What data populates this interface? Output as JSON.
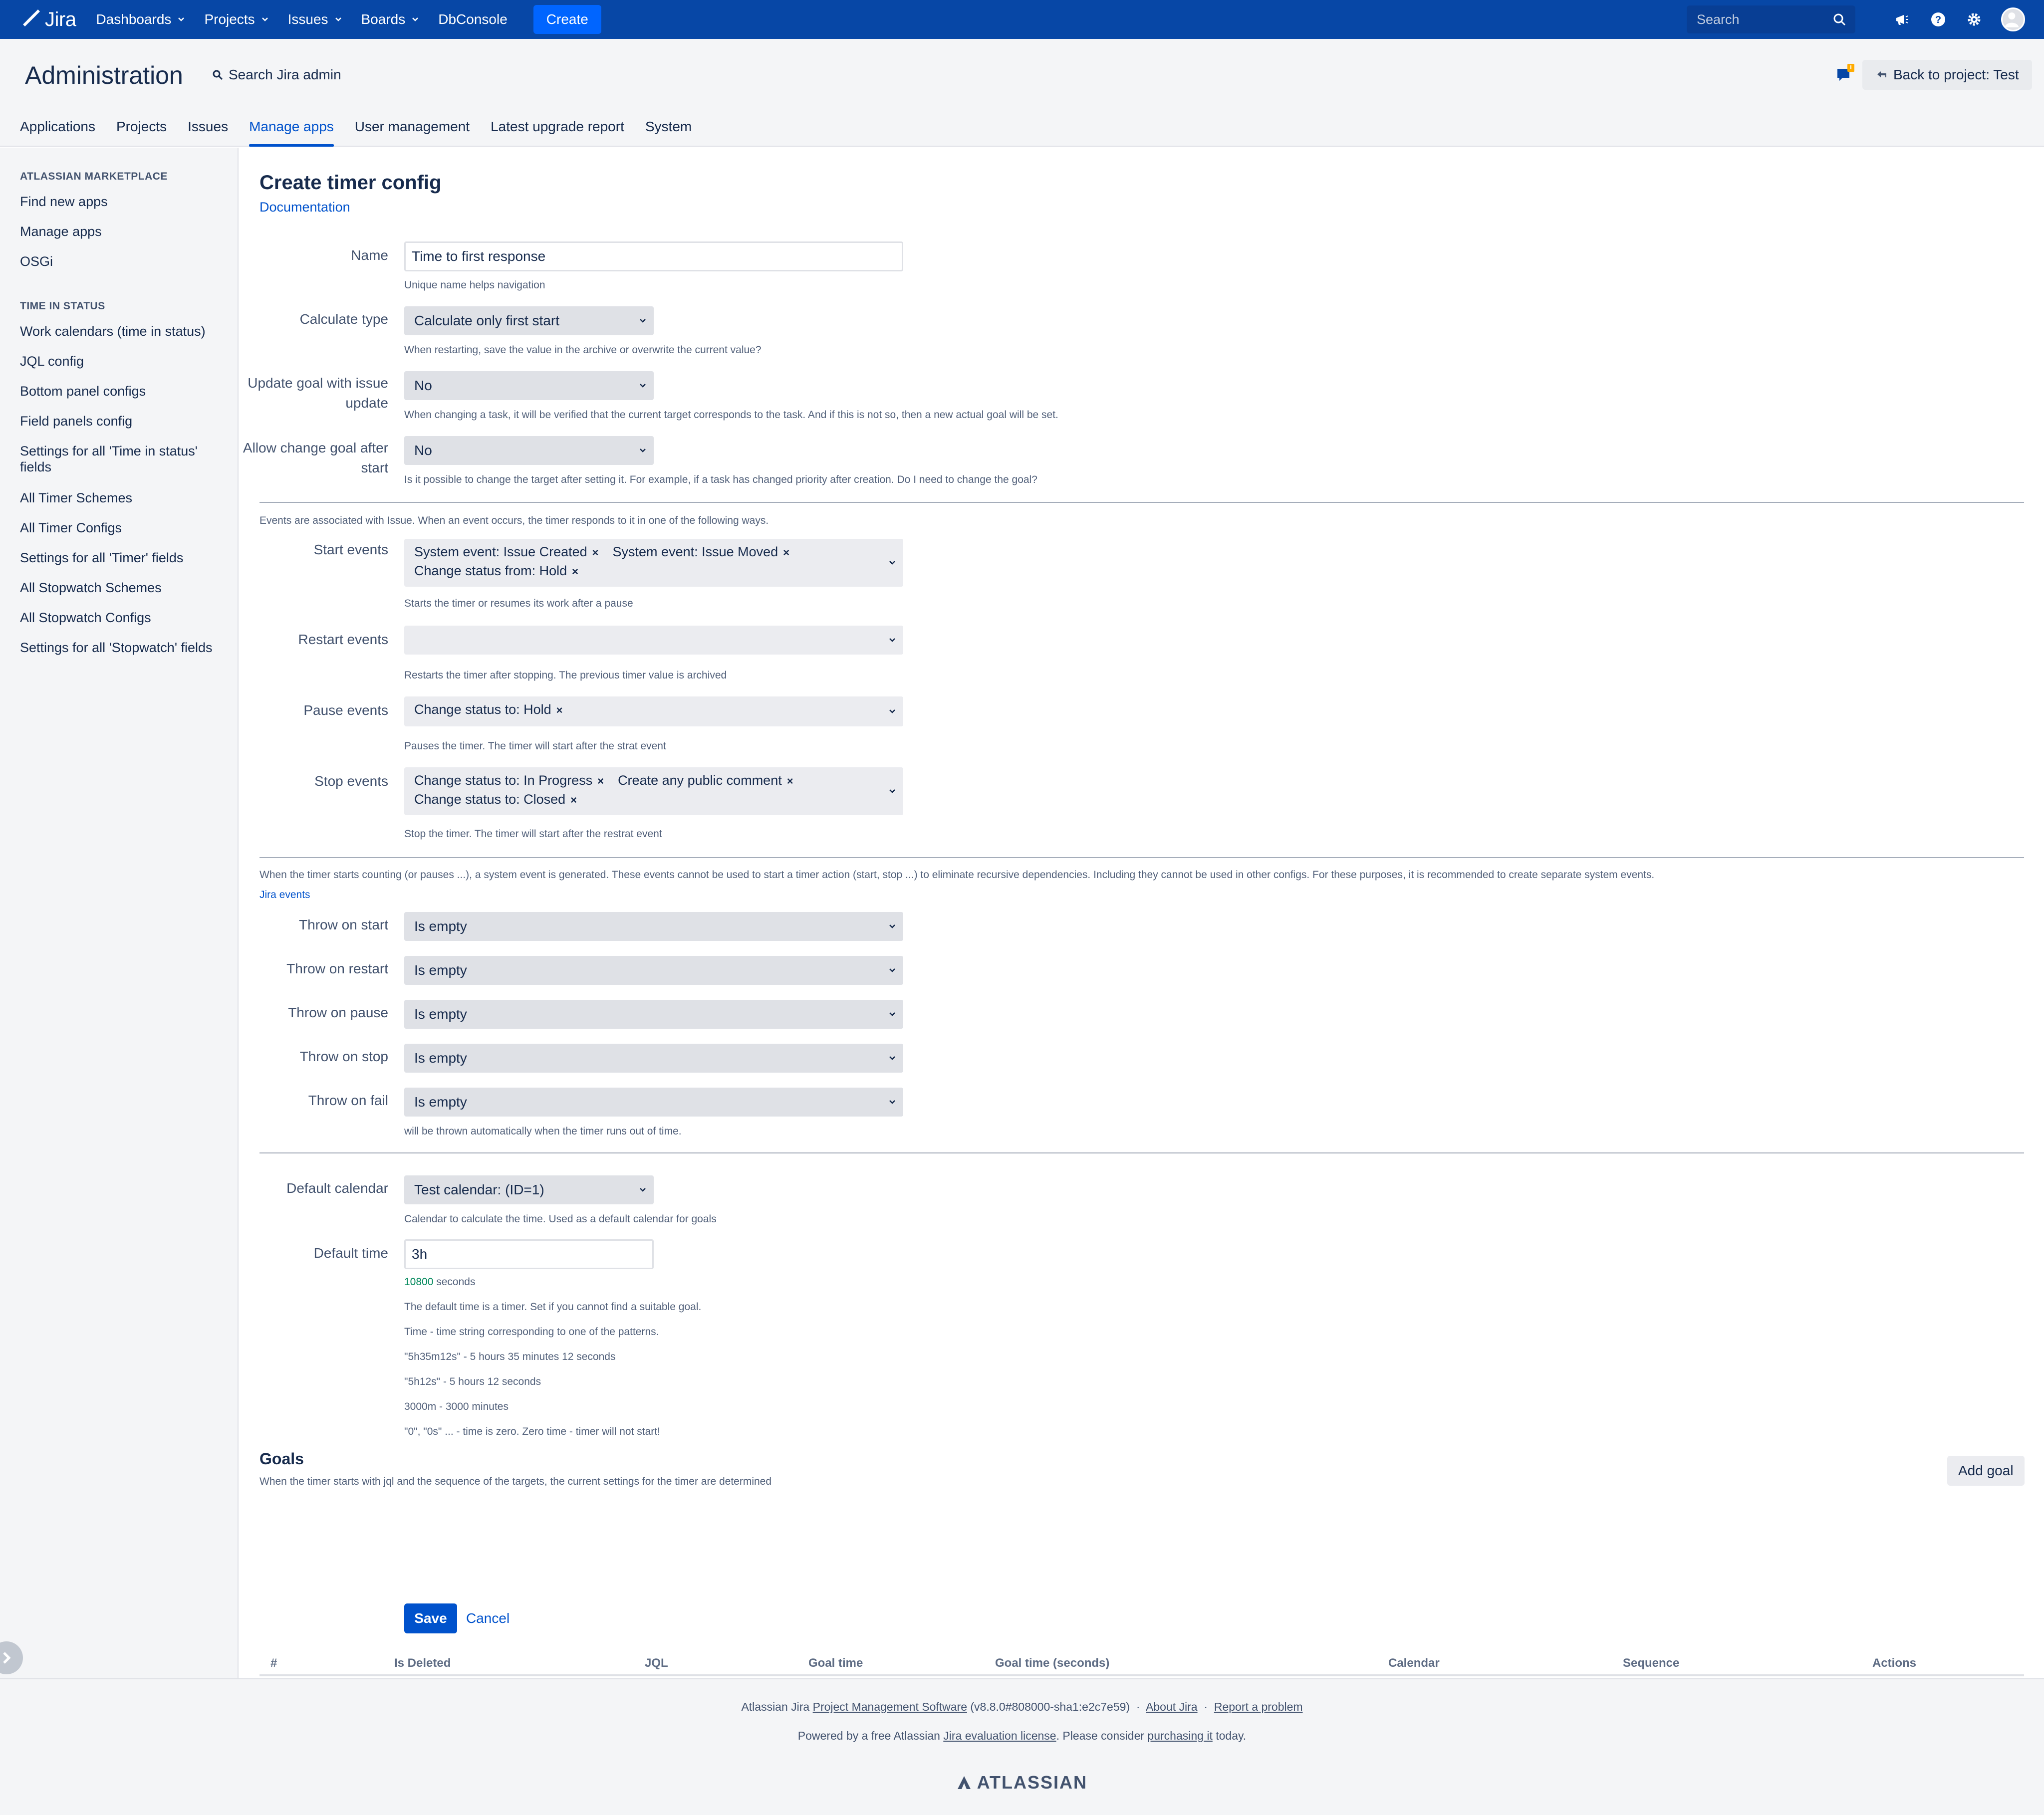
{
  "topnav": {
    "logo_text": "Jira",
    "items": [
      "Dashboards",
      "Projects",
      "Issues",
      "Boards"
    ],
    "dbconsole": "DbConsole",
    "create_label": "Create",
    "search_placeholder": "Search",
    "brand_color": "#0747a6"
  },
  "admin": {
    "title": "Administration",
    "search_label": "Search Jira admin",
    "back_label": "Back to project: Test",
    "tabs": [
      "Applications",
      "Projects",
      "Issues",
      "Manage apps",
      "User management",
      "Latest upgrade report",
      "System"
    ],
    "active_tab": "Manage apps"
  },
  "sidebar": {
    "marketplace_heading": "ATLASSIAN MARKETPLACE",
    "marketplace_items": [
      "Find new apps",
      "Manage apps",
      "OSGi"
    ],
    "tis_heading": "TIME IN STATUS",
    "tis_items": [
      "Work calendars (time in status)",
      "JQL config",
      "Bottom panel configs",
      "Field panels config",
      "Settings for all 'Time in status' fields",
      "All Timer Schemes",
      "All Timer Configs",
      "Settings for all 'Timer' fields",
      "All Stopwatch Schemes",
      "All Stopwatch Configs",
      "Settings for all 'Stopwatch' fields"
    ]
  },
  "form": {
    "title": "Create timer config",
    "doc_link": "Documentation",
    "name": {
      "label": "Name",
      "value": "Time to first response",
      "hint": "Unique name helps navigation"
    },
    "calculate_type": {
      "label": "Calculate type",
      "value": "Calculate only first start",
      "hint": "When restarting, save the value in the archive or overwrite the current value?"
    },
    "update_goal": {
      "label": "Update goal with issue update",
      "value": "No",
      "hint": "When changing a task, it will be verified that the current target corresponds to the task. And if this is not so, then a new actual goal will be set."
    },
    "allow_change": {
      "label": "Allow change goal after start",
      "value": "No",
      "hint": "Is it possible to change the target after setting it. For example, if a task has changed priority after creation. Do I need to change the goal?"
    },
    "events_note": "Events are associated with Issue. When an event occurs, the timer responds to it in one of the following ways.",
    "start_events": {
      "label": "Start events",
      "tags": [
        "System event: Issue Created",
        "System event: Issue Moved",
        "Change status from: Hold"
      ],
      "hint": "Starts the timer or resumes its work after a pause"
    },
    "restart_events": {
      "label": "Restart events",
      "tags": [],
      "hint": "Restarts the timer after stopping. The previous timer value is archived"
    },
    "pause_events": {
      "label": "Pause events",
      "tags": [
        "Change status to: Hold"
      ],
      "hint": "Pauses the timer. The timer will start after the strat event"
    },
    "stop_events": {
      "label": "Stop events",
      "tags": [
        "Change status to: In Progress",
        "Create any public comment",
        "Change status to: Closed"
      ],
      "hint": "Stop the timer. The timer will start after the restrat event"
    },
    "system_note": "When the timer starts counting (or pauses ...), a system event is generated. These events cannot be used to start a timer action (start, stop ...) to eliminate recursive dependencies. Including they cannot be used in other configs. For these purposes, it is recommended to create separate system events.",
    "jira_events_link": "Jira events",
    "throw_on_start": {
      "label": "Throw on start",
      "value": "Is empty"
    },
    "throw_on_restart": {
      "label": "Throw on restart",
      "value": "Is empty"
    },
    "throw_on_pause": {
      "label": "Throw on pause",
      "value": "Is empty"
    },
    "throw_on_stop": {
      "label": "Throw on stop",
      "value": "Is empty"
    },
    "throw_on_fail": {
      "label": "Throw on fail",
      "value": "Is empty",
      "hint": "will be thrown automatically when the timer runs out of time."
    },
    "default_calendar": {
      "label": "Default calendar",
      "value": "Test calendar: (ID=1)",
      "hint": "Calendar to calculate the time. Used as a default calendar for goals"
    },
    "default_time": {
      "label": "Default time",
      "value": "3h",
      "seconds_value": "10800",
      "seconds_unit": "seconds",
      "hints": [
        "The default time is a timer. Set if you cannot find a suitable goal.",
        "Time - time string corresponding to one of the patterns.",
        "\"5h35m12s\" - 5 hours 35 minutes 12 seconds",
        "\"5h12s\" - 5 hours 12 seconds",
        "3000m - 3000 minutes",
        "\"0\", \"0s\" ... - time is zero. Zero time - timer will not start!"
      ]
    },
    "goals": {
      "title": "Goals",
      "note": "When the timer starts with jql and the sequence of the targets, the current settings for the timer are determined",
      "add_label": "Add goal",
      "columns": [
        "#",
        "Is Deleted",
        "JQL",
        "Goal time",
        "Goal time (seconds)",
        "Calendar",
        "Sequence",
        "Actions"
      ]
    },
    "save_label": "Save",
    "cancel_label": "Cancel"
  },
  "footer": {
    "line1_prefix": "Atlassian Jira",
    "line1_link1": "Project Management Software",
    "line1_version": "(v8.8.0#808000-sha1:e2c7e59)",
    "line1_sep": "·",
    "line1_link2": "About Jira",
    "line1_link3": "Report a problem",
    "line2_prefix": "Powered by a free Atlassian",
    "line2_link1": "Jira evaluation license",
    "line2_mid": ". Please consider",
    "line2_link2": "purchasing it",
    "line2_suffix": "today.",
    "logo": "ATLASSIAN"
  }
}
